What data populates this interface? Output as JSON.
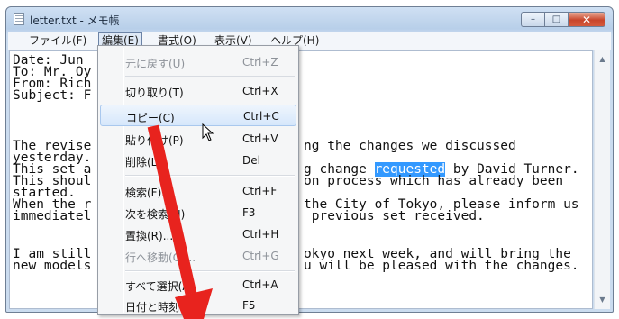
{
  "window": {
    "title": "letter.txt - メモ帳",
    "caption_buttons": {
      "minimize": "–",
      "maximize": "□",
      "close": "✕"
    }
  },
  "menubar": {
    "file": "ファイル(F)",
    "edit": "編集(E)",
    "format": "書式(O)",
    "view": "表示(V)",
    "help": "ヘルプ(H)"
  },
  "editor": {
    "lines": [
      "Date: Jun",
      "To: Mr. Oy",
      "From: Rich",
      "Subject: F",
      "",
      "The revise",
      "yesterday.",
      "This set a",
      "This shoul",
      "started.",
      "When the r",
      "immediatel",
      "",
      "I am still",
      "new models"
    ],
    "right_lines": [
      "ng the changes we discussed",
      "",
      "g change ",
      "on process which has already been",
      "",
      "the City of Tokyo, please inform us",
      " previous set received.",
      "",
      "okyo next week, and will bring the",
      "u will be pleased with the changes."
    ],
    "selected_word": "requested",
    "after_selection": " by David Turner."
  },
  "edit_menu": {
    "items": [
      {
        "label": "元に戻す(U)",
        "shortcut": "Ctrl+Z",
        "enabled": false
      },
      {
        "label": "切り取り(T)",
        "shortcut": "Ctrl+X",
        "enabled": true
      },
      {
        "label": "コピー(C)",
        "shortcut": "Ctrl+C",
        "enabled": true
      },
      {
        "label": "貼り付け(P)",
        "shortcut": "Ctrl+V",
        "enabled": true
      },
      {
        "label": "削除(L)",
        "shortcut": "Del",
        "enabled": true
      },
      {
        "label": "検索(F)...",
        "shortcut": "Ctrl+F",
        "enabled": true
      },
      {
        "label": "次を検索(N)",
        "shortcut": "F3",
        "enabled": true
      },
      {
        "label": "置換(R)...",
        "shortcut": "Ctrl+H",
        "enabled": true
      },
      {
        "label": "行へ移動(G)...",
        "shortcut": "Ctrl+G",
        "enabled": false
      },
      {
        "label": "すべて選択(A)",
        "shortcut": "Ctrl+A",
        "enabled": true
      },
      {
        "label": "日付と時刻(D)",
        "shortcut": "F5",
        "enabled": true
      }
    ],
    "highlighted": "コピー(C)"
  },
  "annotation": {
    "arrow_color": "#e8231e"
  },
  "scrollbar": {
    "up": "▲",
    "down": "▼"
  }
}
